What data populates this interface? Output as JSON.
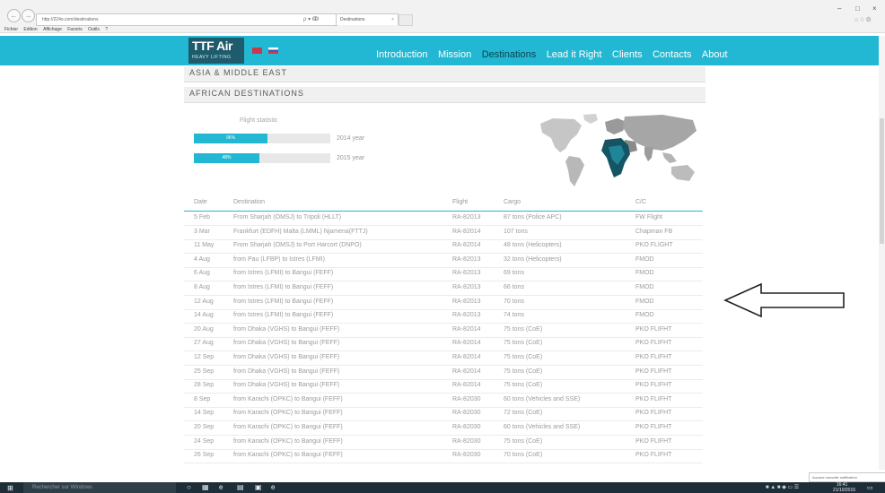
{
  "browser": {
    "url": "http://224o.com/destinations",
    "addr_controls": "ρ ▾ ↂ",
    "tab_title": "Destinations",
    "tab_close": "×",
    "menus": [
      "Fichier",
      "Edition",
      "Affichage",
      "Favoris",
      "Outils",
      "?"
    ],
    "back": "←",
    "forward": "→",
    "win_min": "–",
    "win_max": "□",
    "win_close": "×",
    "right_icons": "⌂☆⚙"
  },
  "site": {
    "logo_main": "TTF Air",
    "logo_sub": "HEAVY LIFTING",
    "nav": [
      {
        "label": "Introduction"
      },
      {
        "label": "Mission"
      },
      {
        "label": "Destinations"
      },
      {
        "label": "Lead it Right"
      },
      {
        "label": "Clients"
      },
      {
        "label": "Contacts"
      },
      {
        "label": "About"
      }
    ],
    "colors": {
      "accent": "#22b8d3",
      "logo_bg": "#1e5b6c",
      "active_nav": "#0a4352"
    }
  },
  "sections": {
    "asia": "ASIA & MIDDLE EAST",
    "africa": "AFRICAN DESTINATIONS"
  },
  "stats": {
    "title": "Flight statistic",
    "bars": [
      {
        "label": "96%",
        "year": "2014 year",
        "fraction": 0.54
      },
      {
        "label": "48%",
        "year": "2015 year",
        "fraction": 0.48
      }
    ]
  },
  "table": {
    "headers": [
      "Date",
      "Destination",
      "Flight",
      "Cargo",
      "C/C"
    ],
    "rows": [
      [
        "5 Feb",
        "From Sharjah (OMSJ) to Tripoli (HLLT)",
        "RA-82013",
        "87 tons (Police APC)",
        "FW Flight"
      ],
      [
        "3 Mar",
        "Frankfurt (EDFH) Malta (LMML) Njamena(FTTJ)",
        "RA-82014",
        "107 tons",
        "Chapman FB"
      ],
      [
        "11 May",
        "From Sharjah (OMSJ) to Port Harcort (DNPO)",
        "RA-82014",
        "48 tons (Helicopters)",
        "PKO FLIGHT"
      ],
      [
        "4 Aug",
        "from Pau (LFBP) to Istres (LFMI)",
        "RA-82013",
        "32 tons (Helicopters)",
        "FMOD"
      ],
      [
        "6 Aug",
        "from Istres (LFMI) to Bangui (FEFF)",
        "RA-82013",
        "69 tons",
        "FMOD"
      ],
      [
        "8 Aug",
        "from Istres (LFMI) to Bangui (FEFF)",
        "RA-82013",
        "66 tons",
        "FMOD"
      ],
      [
        "12 Aug",
        "from Istres (LFMI) to Bangui (FEFF)",
        "RA-82013",
        "70 tons",
        "FMOD"
      ],
      [
        "14 Aug",
        "from Istres (LFMI) to Bangui (FEFF)",
        "RA-82013",
        "74 tons",
        "FMOD"
      ],
      [
        "20 Aug",
        "from Dhaka (VGHS) to Bangui (FEFF)",
        "RA-82014",
        "75 tons (CoE)",
        "PKO FLIFHT"
      ],
      [
        "27 Aug",
        "from Dhaka (VGHS) to Bangui (FEFF)",
        "RA-82014",
        "75 tons (CoE)",
        "PKO FLIFHT"
      ],
      [
        "12 Sep",
        "from Dhaka (VGHS) to Bangui (FEFF)",
        "RA-82014",
        "75 tons (CoE)",
        "PKO FLIFHT"
      ],
      [
        "25 Sep",
        "from Dhaka (VGHS) to Bangui (FEFF)",
        "RA-82014",
        "75 tons (CoE)",
        "PKO FLIFHT"
      ],
      [
        "28 Sep",
        "from Dhaka (VGHS) to Bangui (FEFF)",
        "RA-82014",
        "75 tons (CoE)",
        "PKO FLIFHT"
      ],
      [
        "8 Sep",
        "from Karachi (OPKC) to Bangui (FEFF)",
        "RA-82030",
        "60 tons (Vehicles and SSE)",
        "PKO FLIFHT"
      ],
      [
        "14 Sep",
        "from Karachi (OPKC) to Bangui (FEFF)",
        "RA-82030",
        "72 tons (CoE)",
        "PKO FLIFHT"
      ],
      [
        "20 Sep",
        "from Karachi (OPKC) to Bangui (FEFF)",
        "RA-82030",
        "60 tons (Vehicles and SSE)",
        "PKO FLIFHT"
      ],
      [
        "24 Sep",
        "from Karachi (OPKC) to Bangui (FEFF)",
        "RA-82030",
        "75 tons (CoE)",
        "PKO FLIFHT"
      ],
      [
        "26 Sep",
        "from Karachi (OPKC) to Bangui (FEFF)",
        "RA-82030",
        "70 tons (CoE)",
        "PKO FLIFHT"
      ]
    ]
  },
  "notification": "Aucune nouvelle notification",
  "taskbar": {
    "search": "Rechercher sur Windows",
    "apps": [
      "○",
      "▦",
      "e",
      "▤",
      "▣",
      "e"
    ],
    "tray": "■ ▲ ■ ◆ ▭ ☰",
    "time": "16:41",
    "date": "21/10/2016"
  }
}
